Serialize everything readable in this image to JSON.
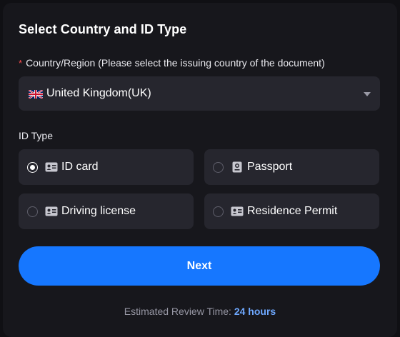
{
  "form": {
    "title": "Select Country and ID Type",
    "country_field": {
      "required_mark": "*",
      "label": "Country/Region (Please select the issuing country of the document)",
      "selected_value": "United Kingdom(UK)",
      "flag_icon": "uk-flag-icon"
    },
    "id_type": {
      "label": "ID Type",
      "options": [
        {
          "label": "ID card",
          "icon": "id-card-icon",
          "selected": true
        },
        {
          "label": "Passport",
          "icon": "passport-icon",
          "selected": false
        },
        {
          "label": "Driving license",
          "icon": "id-card-icon",
          "selected": false
        },
        {
          "label": "Residence Permit",
          "icon": "id-card-icon",
          "selected": false
        }
      ]
    },
    "next_label": "Next",
    "review": {
      "prefix": "Estimated Review Time:",
      "value": "24 hours"
    }
  },
  "colors": {
    "accent": "#1677ff",
    "required": "#ff4d4f",
    "review_highlight": "#6ea8ff",
    "card_bg": "#17171c",
    "field_bg": "#26262e"
  }
}
